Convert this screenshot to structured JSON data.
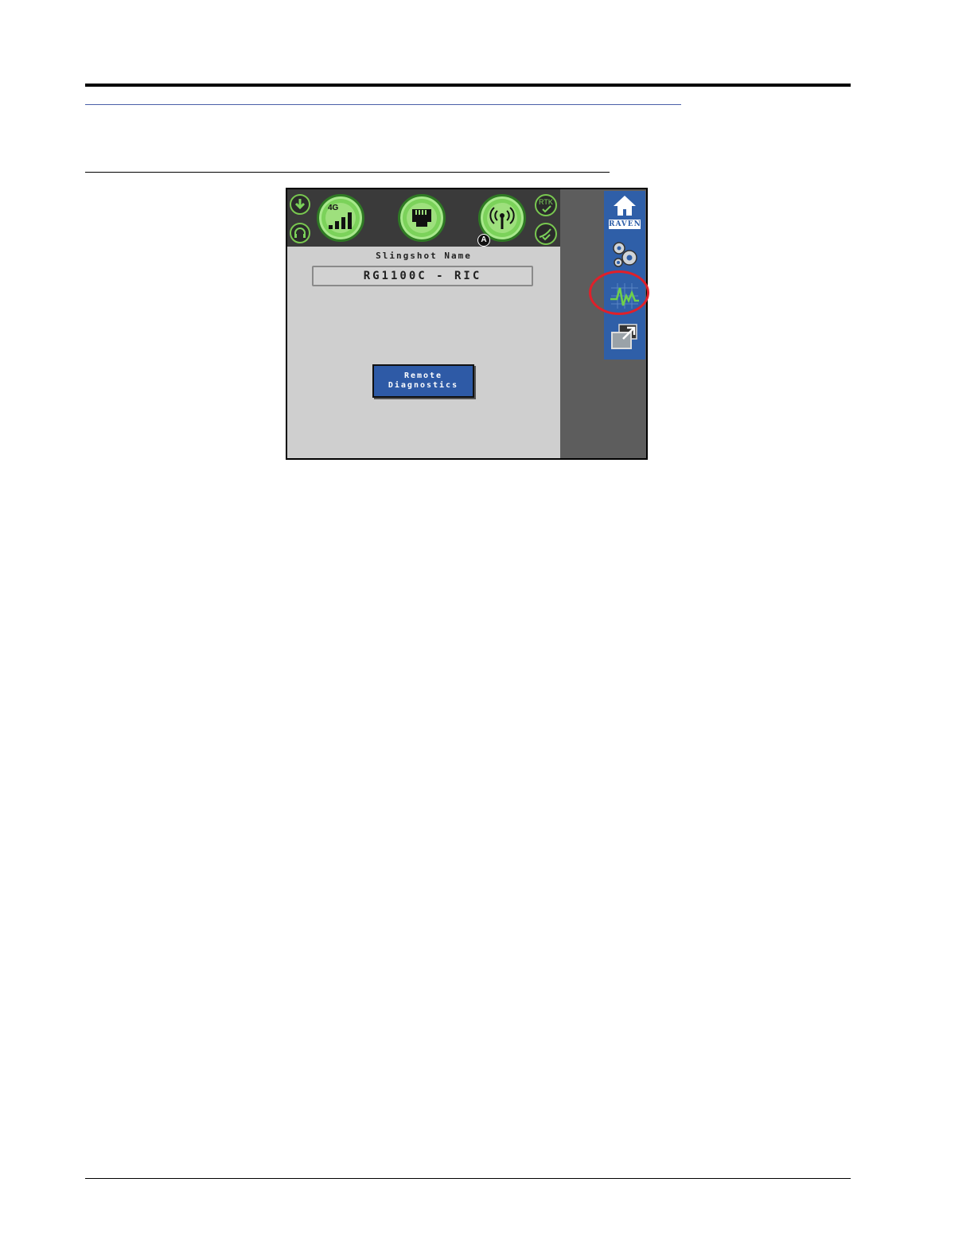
{
  "screen": {
    "status": {
      "cellular_label": "4G",
      "gps_badge": "A",
      "rtk_label": "RTK"
    },
    "content": {
      "name_label": "Slingshot Name",
      "name_value": "RG1100C - RIC",
      "diagnostics_button": [
        "Remote",
        "Diagnostics"
      ]
    },
    "sidebar": {
      "logo_text": "RAVEN",
      "items": [
        "home",
        "settings",
        "diagnostics",
        "external-display"
      ],
      "highlighted": "diagnostics"
    }
  },
  "colors": {
    "sidebar_blue": "#2f5fa8",
    "status_green": "#7bd25a",
    "highlight_red": "#e0202a",
    "content_gray": "#cfcfcf"
  }
}
